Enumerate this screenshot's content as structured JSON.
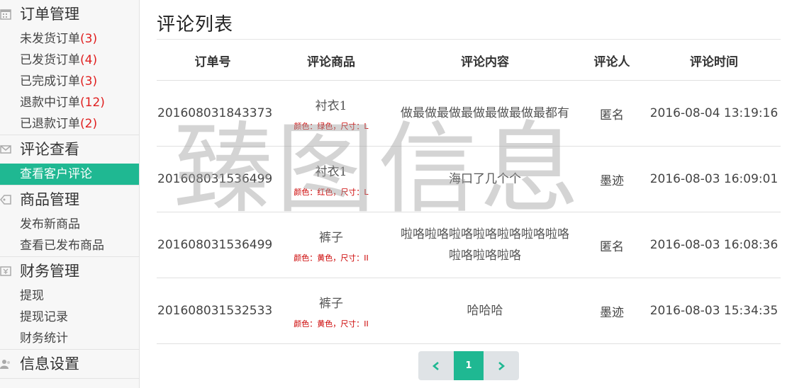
{
  "sidebar": {
    "sections": [
      {
        "title": "订单管理",
        "icon": "calendar-icon",
        "items": [
          {
            "label": "未发货订单",
            "count": "(3)"
          },
          {
            "label": "已发货订单",
            "count": "(4)"
          },
          {
            "label": "已完成订单",
            "count": "(3)"
          },
          {
            "label": "退款中订单",
            "count": "(12)"
          },
          {
            "label": "已退款订单",
            "count": "(2)"
          }
        ]
      },
      {
        "title": "评论查看",
        "icon": "mail-icon",
        "items": [
          {
            "label": "查看客户评论",
            "active": true
          }
        ]
      },
      {
        "title": "商品管理",
        "icon": "tag-icon",
        "items": [
          {
            "label": "发布新商品"
          },
          {
            "label": "查看已发布商品"
          }
        ]
      },
      {
        "title": "财务管理",
        "icon": "yen-icon",
        "items": [
          {
            "label": "提现"
          },
          {
            "label": "提现记录"
          },
          {
            "label": "财务统计"
          }
        ]
      },
      {
        "title": "信息设置",
        "icon": "users-icon",
        "items": []
      }
    ]
  },
  "main": {
    "title": "评论列表",
    "columns": [
      "订单号",
      "评论商品",
      "评论内容",
      "评论人",
      "评论时间"
    ],
    "rows": [
      {
        "order": "201608031843373",
        "product": "衬衣1",
        "attrs": "颜色：绿色，尺寸：L",
        "content": "做最做最做最做最做最做最都有",
        "user": "匿名",
        "time": "2016-08-04 13:19:16"
      },
      {
        "order": "201608031536499",
        "product": "衬衣1",
        "attrs": "颜色：红色，尺寸：L",
        "content": "海口了几个个",
        "user": "墨迹",
        "time": "2016-08-03 16:09:01"
      },
      {
        "order": "201608031536499",
        "product": "裤子",
        "attrs": "颜色：黄色，尺寸：II",
        "content": "啦咯啦咯啦咯啦咯啦咯啦咯啦咯啦咯啦咯啦咯",
        "user": "匿名",
        "time": "2016-08-03 16:08:36"
      },
      {
        "order": "201608031532533",
        "product": "裤子",
        "attrs": "颜色：黄色，尺寸：II",
        "content": "哈哈哈",
        "user": "墨迹",
        "time": "2016-08-03 15:34:35"
      }
    ],
    "watermark": "臻图信息"
  },
  "pager": {
    "current": "1",
    "prev_icon": "chevron-left-icon",
    "next_icon": "chevron-right-icon"
  },
  "colors": {
    "accent": "#1fb892",
    "count_red": "#e02020",
    "attr_red": "#cc0000"
  }
}
